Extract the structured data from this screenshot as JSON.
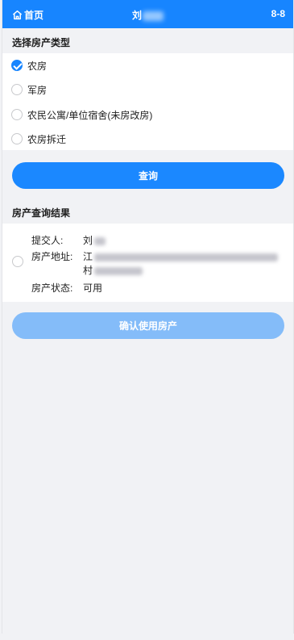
{
  "header": {
    "home_label": "首页",
    "title": "刘",
    "version": "8-8"
  },
  "property_type": {
    "heading": "选择房产类型",
    "options": [
      {
        "label": "农房",
        "selected": true
      },
      {
        "label": "军房",
        "selected": false
      },
      {
        "label": "农民公寓/单位宿舍(未房改房)",
        "selected": false
      },
      {
        "label": "农房拆迁",
        "selected": false
      }
    ]
  },
  "query_button": "查询",
  "results": {
    "heading": "房产查询结果",
    "items": [
      {
        "submitter_key": "提交人:",
        "submitter_value": "刘",
        "address_key": "房产地址:",
        "address_line1": "江",
        "address_line2": "村",
        "status_key": "房产状态:",
        "status_value": "可用"
      }
    ]
  },
  "confirm_button": "确认使用房产"
}
